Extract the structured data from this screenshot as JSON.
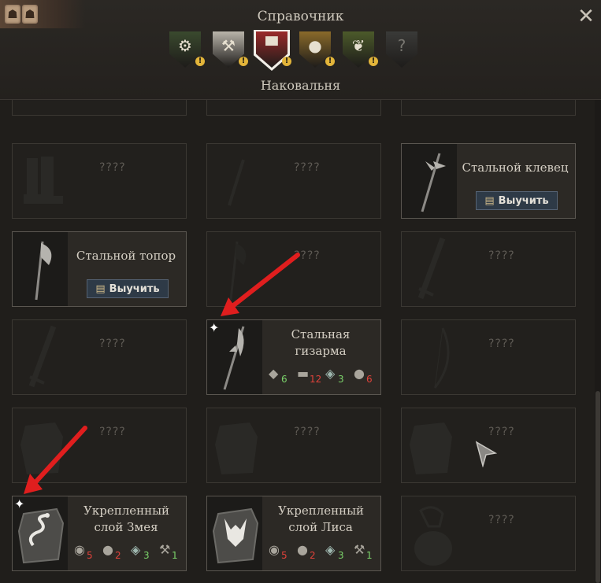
{
  "header": {
    "title": "Справочник",
    "subtitle": "Наковальня",
    "close_icon": "close-icon",
    "tabs": [
      {
        "name": "tab-gear",
        "icon": "gear-icon",
        "color": "#3a4a2e",
        "glyph": "⚙",
        "alert": "!"
      },
      {
        "name": "tab-tools",
        "icon": "hammer-wrench-icon",
        "color": "#b9b4aa",
        "glyph": "⚒",
        "alert": "!"
      },
      {
        "name": "tab-anvil",
        "icon": "anvil-icon",
        "color": "#9a2a2a",
        "glyph": "▀",
        "alert": "!",
        "selected": true
      },
      {
        "name": "tab-cauldron",
        "icon": "cauldron-icon",
        "color": "#8a6a2a",
        "glyph": "●",
        "alert": "!"
      },
      {
        "name": "tab-herbs",
        "icon": "herbs-icon",
        "color": "#4c5a2a",
        "glyph": "❦",
        "alert": "!"
      },
      {
        "name": "tab-unknown",
        "icon": "question-icon",
        "color": "#3a3a38",
        "glyph": "?",
        "alert": ""
      }
    ]
  },
  "learn_label": "Выучить",
  "unknown_label": "????",
  "cards": [
    {
      "state": "unknown",
      "icon": "boots-icon"
    },
    {
      "state": "unknown",
      "icon": "spear-icon"
    },
    {
      "state": "learnable",
      "name": "Стальной клевец",
      "icon": "war-pick-icon"
    },
    {
      "state": "learnable",
      "name": "Стальной топор",
      "icon": "axe-icon"
    },
    {
      "state": "unknown",
      "icon": "axe-icon"
    },
    {
      "state": "unknown",
      "icon": "sword-icon"
    },
    {
      "state": "unknown",
      "icon": "sword-icon"
    },
    {
      "state": "recipe",
      "name": "Стальная гизарма",
      "icon": "glaive-icon",
      "new": true,
      "resources": [
        {
          "icon": "ore-icon",
          "count": "6",
          "status": "green"
        },
        {
          "icon": "wood-icon",
          "count": "12",
          "status": "red"
        },
        {
          "icon": "leather-icon",
          "count": "3",
          "status": "green"
        },
        {
          "icon": "coal-icon",
          "count": "6",
          "status": "red"
        }
      ]
    },
    {
      "state": "unknown",
      "icon": "bow-icon"
    },
    {
      "state": "unknown",
      "icon": "armor-icon"
    },
    {
      "state": "unknown",
      "icon": "armor-icon"
    },
    {
      "state": "unknown",
      "icon": "armor-icon"
    },
    {
      "state": "recipe",
      "name": "Укрепленный слой Змея",
      "icon": "snake-armor-icon",
      "new": true,
      "resources": [
        {
          "icon": "cloth-icon",
          "count": "5",
          "status": "red"
        },
        {
          "icon": "coal-icon",
          "count": "2",
          "status": "red"
        },
        {
          "icon": "leather-icon",
          "count": "3",
          "status": "green"
        },
        {
          "icon": "tools-icon",
          "count": "1",
          "status": "green"
        }
      ]
    },
    {
      "state": "recipe",
      "name": "Укрепленный слой Лиса",
      "icon": "fox-armor-icon",
      "new": false,
      "resources": [
        {
          "icon": "cloth-icon",
          "count": "5",
          "status": "red"
        },
        {
          "icon": "coal-icon",
          "count": "2",
          "status": "red"
        },
        {
          "icon": "leather-icon",
          "count": "3",
          "status": "green"
        },
        {
          "icon": "tools-icon",
          "count": "1",
          "status": "green"
        }
      ]
    },
    {
      "state": "unknown",
      "icon": "bag-icon"
    }
  ],
  "colors": {
    "highlight_arrow": "#e01e1e",
    "learn_button": "#2e3a47"
  }
}
